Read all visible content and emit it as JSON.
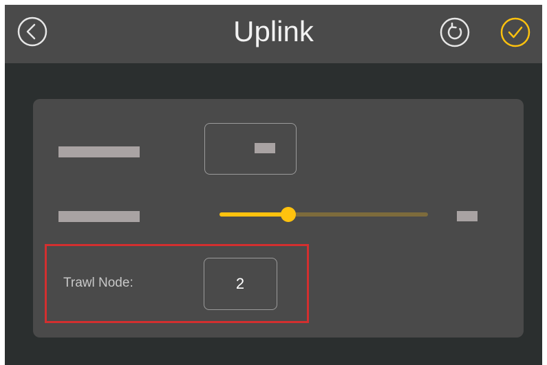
{
  "header": {
    "title": "Uplink",
    "back_icon": "back-arrow-icon",
    "reset_icon": "reset-icon",
    "confirm_icon": "checkmark-icon"
  },
  "panel": {
    "redacted_row": {
      "value_box": true
    },
    "slider_row": {
      "level_fraction": 0.33
    },
    "trawl_node": {
      "label": "Trawl Node:",
      "value": "2"
    }
  },
  "colors": {
    "accent": "#ffc20e",
    "header_bg": "#4a4a4a",
    "screen_bg": "#2b2f2f",
    "panel_bg": "#4a4a4a",
    "highlight": "#d32f2f"
  }
}
